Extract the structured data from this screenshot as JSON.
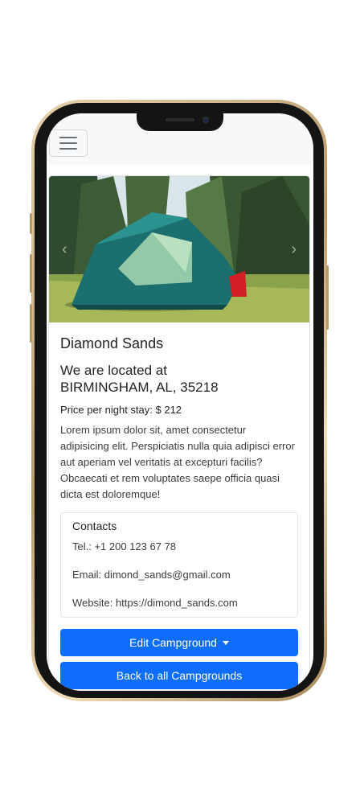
{
  "navbar": {
    "menu_icon": "hamburger-icon"
  },
  "campground": {
    "name": "Diamond Sands",
    "location_prefix": "We are located at",
    "location": "BIRMINGHAM, AL, 35218",
    "price_text": "Price per night stay: $ 212",
    "description": "Lorem ipsum dolor sit, amet consectetur adipisicing elit. Perspiciatis nulla quia adipisci error aut aperiam vel veritatis at excepturi facilis? Obcaecati et rem voluptates saepe officia quasi dicta est doloremque!"
  },
  "contacts": {
    "title": "Contacts",
    "phone": "Tel.: +1 200 123 67 78",
    "email": "Email: dimond_sands@gmail.com",
    "website": "Website: https://dimond_sands.com"
  },
  "actions": {
    "edit_label": "Edit Campground",
    "back_label": "Back to all Campgrounds"
  },
  "colors": {
    "primary": "#0d6efd",
    "tent": "#1e8a87",
    "frame": "#c9ad7f"
  }
}
